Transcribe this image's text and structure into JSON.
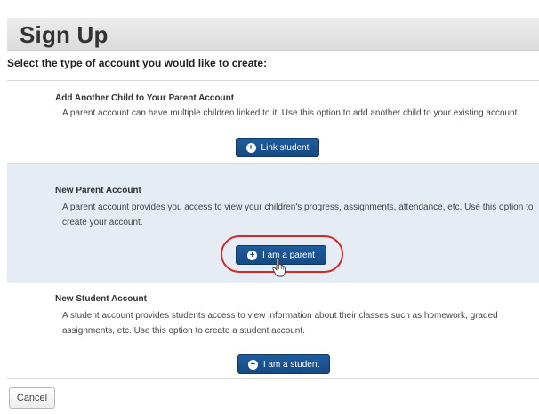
{
  "page": {
    "title": "Sign Up",
    "subtitle": "Select the type of account you would like to create:"
  },
  "options": [
    {
      "title": "Add Another Child to Your Parent Account",
      "description": "A parent account can have multiple children linked to it. Use this option to add another child to your existing account.",
      "button_label": "Link student",
      "button_icon": "plus-circle-icon"
    },
    {
      "title": "New Parent Account",
      "description": "A parent account provides you access to view your children's progress, assignments, attendance, etc. Use this option to create your account.",
      "button_label": "I am a parent",
      "button_icon": "plus-circle-icon",
      "highlighted": true
    },
    {
      "title": "New Student Account",
      "description": "A student account provides students access to view information about their classes such as homework, graded assignments, etc. Use this option to create a student account.",
      "button_label": "I am a student",
      "button_icon": "plus-circle-icon"
    }
  ],
  "footer": {
    "cancel_label": "Cancel"
  },
  "colors": {
    "button": "#1a5290",
    "highlight_panel": "#e6ecf4",
    "annotation_ring": "#d32a2a"
  }
}
